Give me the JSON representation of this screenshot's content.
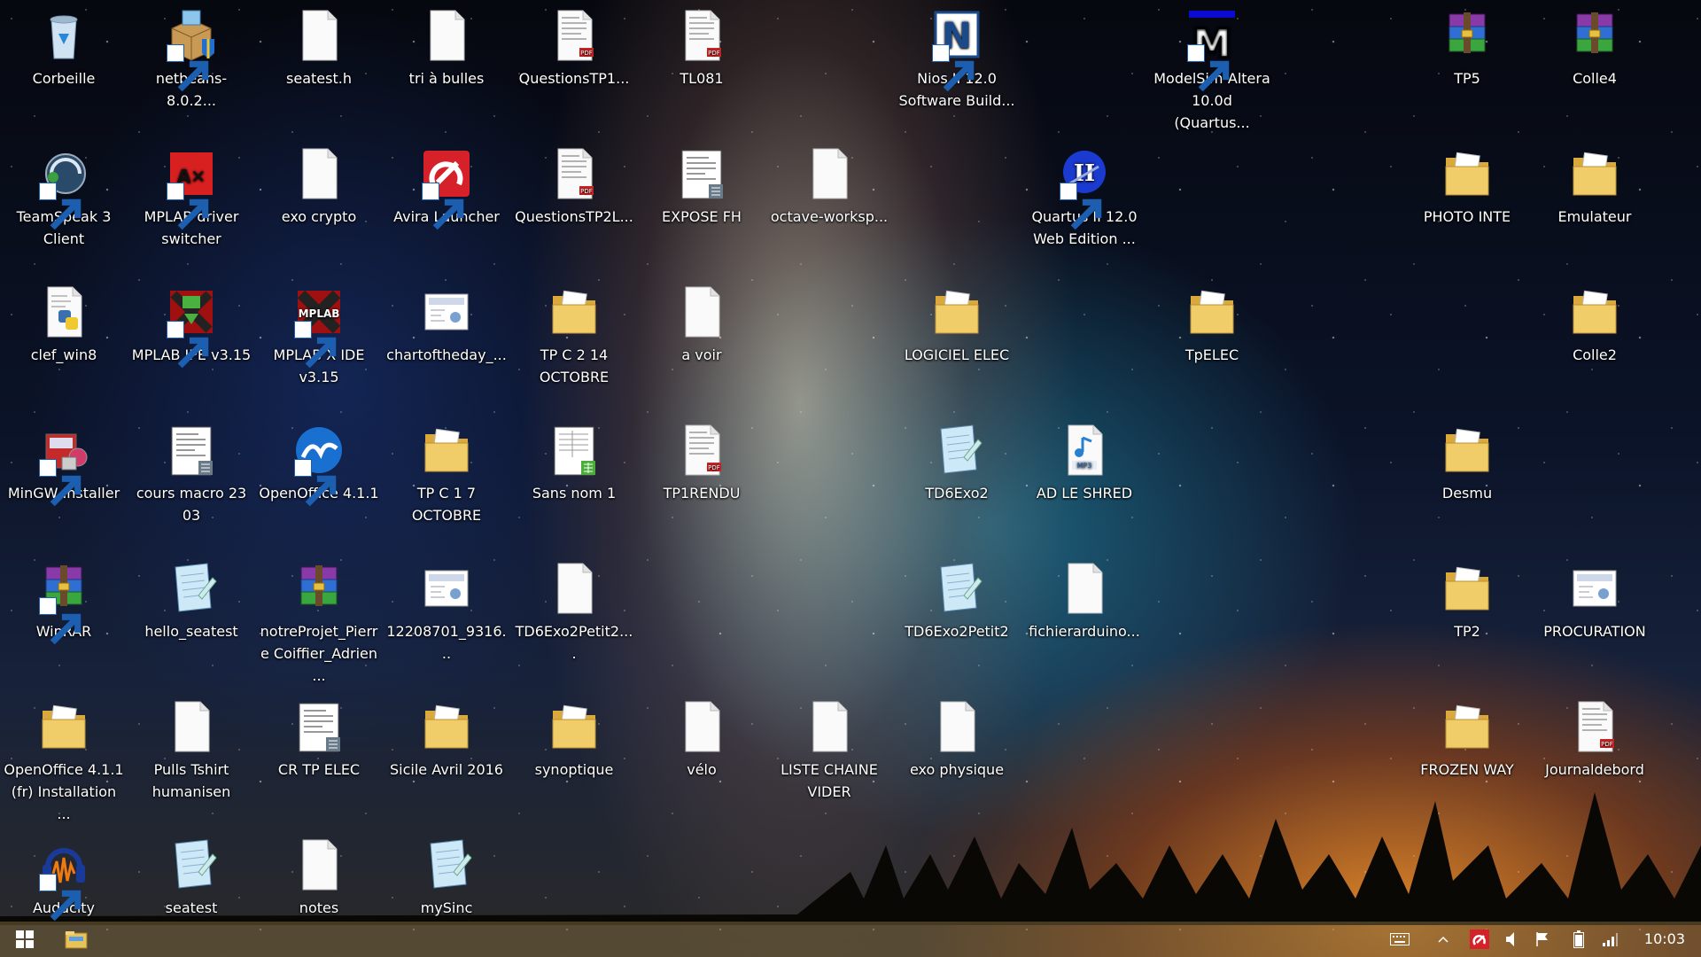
{
  "desktop": {
    "icons": [
      {
        "label": "Corbeille",
        "kind": "recycle"
      },
      {
        "label": "netbeans-8.0.2...",
        "kind": "installer"
      },
      {
        "label": "seatest.h",
        "kind": "file"
      },
      {
        "label": "tri à bulles",
        "kind": "file"
      },
      {
        "label": "QuestionsTP1...",
        "kind": "pdf"
      },
      {
        "label": "TL081",
        "kind": "pdf"
      },
      {
        "label": "Nios II 12.0 Software Build...",
        "kind": "nios"
      },
      {
        "label": "ModelSim-Altera 10.0d (Quartus...",
        "kind": "modelsim"
      },
      {
        "label": "TP5",
        "kind": "rar"
      },
      {
        "label": "Colle4",
        "kind": "rar"
      },
      {
        "label": "TeamSpeak 3 Client",
        "kind": "teamspeak"
      },
      {
        "label": "MPLAB driver switcher",
        "kind": "mplabdrv"
      },
      {
        "label": "exo crypto",
        "kind": "file"
      },
      {
        "label": "Avira Launcher",
        "kind": "avira"
      },
      {
        "label": "QuestionsTP2L...",
        "kind": "pdf"
      },
      {
        "label": "EXPOSE FH",
        "kind": "doc"
      },
      {
        "label": "octave-worksp...",
        "kind": "file"
      },
      {
        "label": "Quartus II 12.0 Web Edition ...",
        "kind": "quartus"
      },
      {
        "label": "PHOTO INTE",
        "kind": "folder"
      },
      {
        "label": "Emulateur",
        "kind": "folder"
      },
      {
        "label": "clef_win8",
        "kind": "python"
      },
      {
        "label": "MPLAB IPE v3.15",
        "kind": "mplabipe"
      },
      {
        "label": "MPLAB X IDE v3.15",
        "kind": "mplabx"
      },
      {
        "label": "chartoftheday_...",
        "kind": "image"
      },
      {
        "label": "TP C  2  14 OCTOBRE",
        "kind": "folder"
      },
      {
        "label": "a voir",
        "kind": "file"
      },
      {
        "label": "LOGICIEL ELEC",
        "kind": "folder"
      },
      {
        "label": "TpELEC",
        "kind": "folder"
      },
      {
        "label": "Colle2",
        "kind": "folder"
      },
      {
        "label": "MinGW Installer",
        "kind": "mingw"
      },
      {
        "label": "cours macro 23 03",
        "kind": "doc"
      },
      {
        "label": "OpenOffice 4.1.1",
        "kind": "openoffice"
      },
      {
        "label": "TP C 1 7 OCTOBRE",
        "kind": "folder"
      },
      {
        "label": "Sans nom 1",
        "kind": "sheet"
      },
      {
        "label": "TP1RENDU",
        "kind": "pdf"
      },
      {
        "label": "TD6Exo2",
        "kind": "notepad"
      },
      {
        "label": "AD LE SHRED",
        "kind": "mp3"
      },
      {
        "label": "Desmu",
        "kind": "folder"
      },
      {
        "label": "WinRAR",
        "kind": "rar"
      },
      {
        "label": "hello_seatest",
        "kind": "notepad"
      },
      {
        "label": "notreProjet_Pierre Coiffier_Adrien ...",
        "kind": "rar"
      },
      {
        "label": "12208701_9316...",
        "kind": "image"
      },
      {
        "label": "TD6Exo2Petit2....",
        "kind": "file"
      },
      {
        "label": "TD6Exo2Petit2",
        "kind": "notepad"
      },
      {
        "label": "fichierarduino...",
        "kind": "file"
      },
      {
        "label": "TP2",
        "kind": "folder"
      },
      {
        "label": "PROCURATION",
        "kind": "image"
      },
      {
        "label": "OpenOffice 4.1.1 (fr) Installation ...",
        "kind": "folder"
      },
      {
        "label": "Pulls Tshirt humanisen",
        "kind": "file"
      },
      {
        "label": "CR TP ELEC",
        "kind": "doc"
      },
      {
        "label": "Sicile Avril 2016",
        "kind": "folder"
      },
      {
        "label": "synoptique",
        "kind": "folder"
      },
      {
        "label": "vélo",
        "kind": "file"
      },
      {
        "label": "LISTE CHAINE VIDER",
        "kind": "file"
      },
      {
        "label": "exo physique",
        "kind": "file"
      },
      {
        "label": "FROZEN WAY",
        "kind": "folder"
      },
      {
        "label": "Journaldebord",
        "kind": "pdf"
      },
      {
        "label": "Audacity",
        "kind": "audacity"
      },
      {
        "label": "seatest",
        "kind": "notepad"
      },
      {
        "label": "notes",
        "kind": "file"
      },
      {
        "label": "mySinc",
        "kind": "notepad"
      }
    ]
  },
  "taskbar": {
    "start_icon": "windows-logo",
    "pinned": [
      "file-explorer"
    ],
    "tray_icons": [
      "keyboard",
      "show-hidden",
      "avira",
      "volume",
      "action-center-flag",
      "battery",
      "network"
    ],
    "clock": "10:03"
  }
}
